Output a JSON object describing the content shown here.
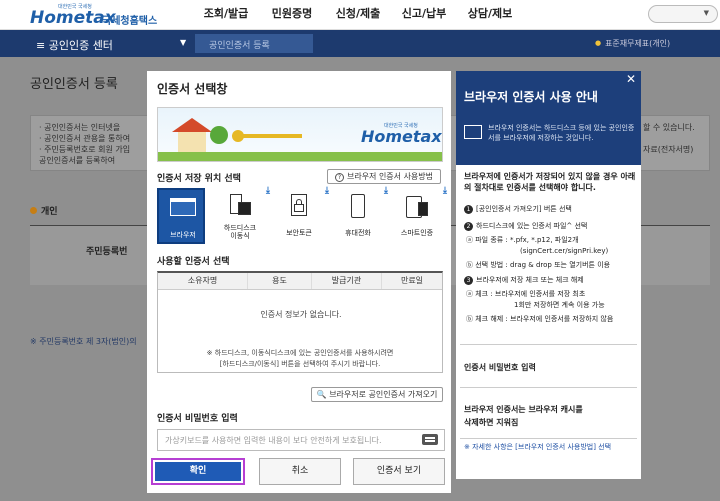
{
  "header": {
    "logo_small": "대한민국 국세청",
    "logo_brand": "Hometax",
    "logo_sub": "국세청홈택스",
    "menu": [
      "조회/발급",
      "민원증명",
      "신청/제출",
      "신고/납부",
      "상담/제보"
    ]
  },
  "nav": {
    "title": "≡  공인인증 센터",
    "crumb": "공인인증서 등록",
    "right": "표준재무제표(개인)"
  },
  "page": {
    "title": "공인인증서 등록",
    "lines": [
      "· 공인인증서는 인터넷을",
      "· 공인인증서 관용을 통하여",
      "· 주민등록번호로 회원 가입",
      "  공인인증서를 등록하여"
    ],
    "right_lines": [
      "할 수 있습니다.",
      "자료(전자서명)"
    ],
    "section": "개인",
    "field_label": "주민등록번",
    "note": "※ 주민등록번호 제 3자(법인)의"
  },
  "modal": {
    "title": "인증서 선택창",
    "banner_small": "대한민국 국세청",
    "banner_logo": "Hometax",
    "location_label": "인증서 저장 위치 선택",
    "help_button": "브라우저 인증서 사용방법",
    "locations": [
      "브라우저",
      "하드디스크\n이동식",
      "보안토큰",
      "휴대전화",
      "스마트인증"
    ],
    "select_label": "사용할 인증서 선택",
    "columns": [
      "소유자명",
      "용도",
      "발급기관",
      "만료일"
    ],
    "empty_message": "인증서 정보가 없습니다.",
    "note_line1": "※ 하드디스크, 이동식디스크에 있는 공인인증서를 사용하시려면",
    "note_line2": "[하드디스크/이동식] 버튼을 선택하여 주시기 바랍니다.",
    "browser_button": "브라우저로 공인인증서 가져오기",
    "password_label": "인증서 비밀번호 입력",
    "password_placeholder": "가상키보드를 사용하면 입력한 내용이 보다 안전하게 보호됩니다.",
    "buttons": {
      "ok": "확인",
      "cancel": "취소",
      "view": "인증서 보기"
    }
  },
  "guide": {
    "title": "브라우저 인증서 사용 안내",
    "desc": "브라우저 인증서는 하드디스크 등에 있는 공인인증서를 브라우저에 저장하는 것입니다.",
    "intro": "브라우저에 인증서가 저장되어 있지 않을 경우 아래의 절차대로 인증서를 선택해야 합니다.",
    "step1": "[공인인증서 가져오기] 버튼 선택",
    "step2": "하드디스크에 있는 인증서 파일^ 선택",
    "step2_type": "ⓐ 파일 종류 : *.pfx, *.p12, 파일2개",
    "step2_type2": "(signCert.cer/signPri.key)",
    "step2_method": "ⓑ 선택 방법 : drag & drop 또는 열기버튼 이용",
    "step3": "브라우저에 저장 체크 또는 체크 해제",
    "step3_check": "ⓐ 체크 : 브라우저에 인증서를 저장 최초",
    "step3_check2": "1회만 저장하면 계속 이용 가능",
    "step3_uncheck": "ⓑ 체크 해제 : 브라우저에 인증서를 저장하지 않음",
    "pw_title": "인증서 비밀번호 입력",
    "cache_title1": "브라우저 인증서는 브라우저 캐시를",
    "cache_title2": "삭제하면 지워짐",
    "link": "※ 자세한 사항은 [브라우저 인증서 사용방법] 선택"
  },
  "colors": {
    "navy": "#1d3a6e",
    "button_blue": "#1f5bb6",
    "highlight": "#b63fd3"
  }
}
